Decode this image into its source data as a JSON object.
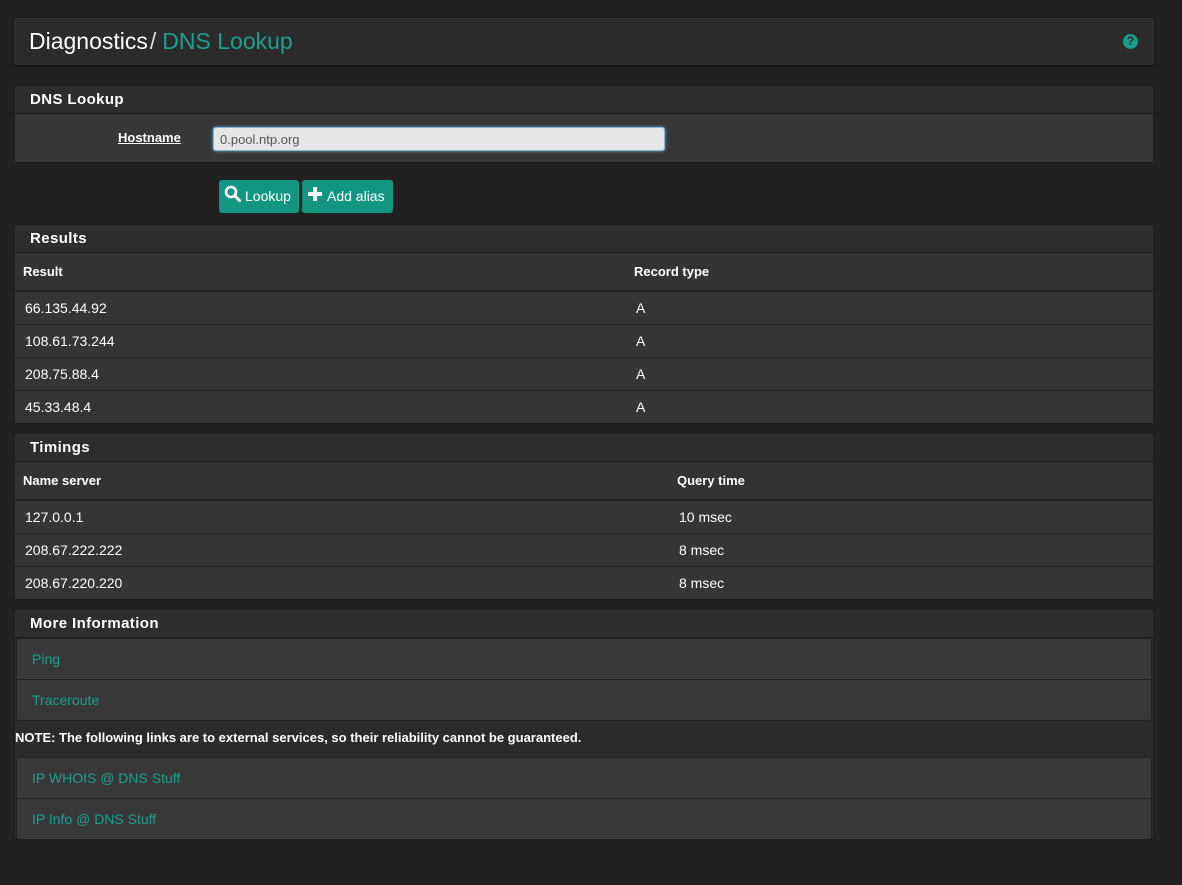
{
  "breadcrumb": {
    "section": "Diagnostics",
    "separator": "/",
    "page": "DNS Lookup"
  },
  "help_icon": "question-circle-icon",
  "dns_lookup": {
    "heading": "DNS Lookup",
    "hostname_label": "Hostname",
    "hostname_value": "0.pool.ntp.org"
  },
  "buttons": {
    "lookup": "Lookup",
    "add_alias": "Add alias"
  },
  "results": {
    "heading": "Results",
    "columns": [
      "Result",
      "Record type"
    ],
    "rows": [
      [
        "66.135.44.92",
        "A"
      ],
      [
        "108.61.73.244",
        "A"
      ],
      [
        "208.75.88.4",
        "A"
      ],
      [
        "45.33.48.4",
        "A"
      ]
    ]
  },
  "timings": {
    "heading": "Timings",
    "columns": [
      "Name server",
      "Query time"
    ],
    "rows": [
      [
        "127.0.0.1",
        "10 msec"
      ],
      [
        "208.67.222.222",
        "8 msec"
      ],
      [
        "208.67.220.220",
        "8 msec"
      ]
    ]
  },
  "more_info": {
    "heading": "More Information",
    "links": [
      "Ping",
      "Traceroute"
    ],
    "note": "NOTE: The following links are to external services, so their reliability cannot be guaranteed.",
    "external_links": [
      "IP WHOIS @ DNS Stuff",
      "IP Info @ DNS Stuff"
    ]
  },
  "colors": {
    "accent": "#1e9f8f",
    "button": "#129682",
    "background": "#212121"
  }
}
